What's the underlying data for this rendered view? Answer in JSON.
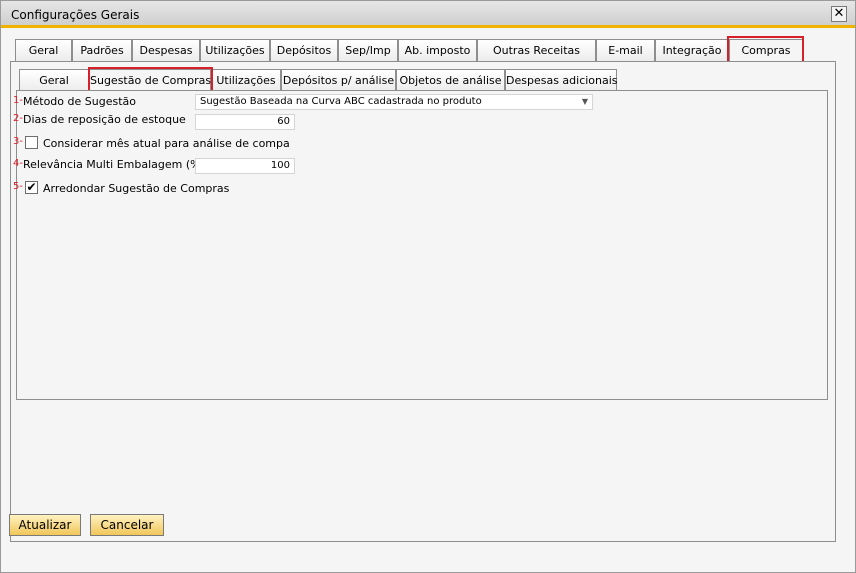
{
  "window": {
    "title": "Configurações Gerais",
    "close_symbol": "✕"
  },
  "tabs": [
    {
      "label": "Geral"
    },
    {
      "label": "Padrões"
    },
    {
      "label": "Despesas"
    },
    {
      "label": "Utilizações"
    },
    {
      "label": "Depósitos"
    },
    {
      "label": "Sep/Imp"
    },
    {
      "label": "Ab. imposto"
    },
    {
      "label": "Outras Receitas"
    },
    {
      "label": "E-mail"
    },
    {
      "label": "Integração"
    },
    {
      "label": "Compras"
    }
  ],
  "subtabs": [
    {
      "label": "Geral"
    },
    {
      "label": "Sugestão de Compras"
    },
    {
      "label": "Utilizações"
    },
    {
      "label": "Depósitos p/ análise"
    },
    {
      "label": "Objetos de análise"
    },
    {
      "label": "Despesas adicionais"
    }
  ],
  "form": {
    "metodo": {
      "num": "1-",
      "label": "Método de Sugestão",
      "value": "Sugestão Baseada na Curva ABC cadastrada no produto"
    },
    "dias": {
      "num": "2-",
      "label": "Dias de reposição de estoque",
      "value": "60"
    },
    "considerar": {
      "num": "3-",
      "label": "Considerar mês atual para análise de compa",
      "checked": false
    },
    "relevancia": {
      "num": "4-",
      "label": "Relevância Multi Embalagem (%)",
      "value": "100"
    },
    "arredondar": {
      "num": "5-",
      "label": "Arredondar Sugestão de Compras",
      "checked": true,
      "check_symbol": "✔"
    }
  },
  "buttons": {
    "atualizar": "Atualizar",
    "cancelar": "Cancelar"
  },
  "colors": {
    "highlight": "#d8202a",
    "accent": "#f0b400"
  }
}
